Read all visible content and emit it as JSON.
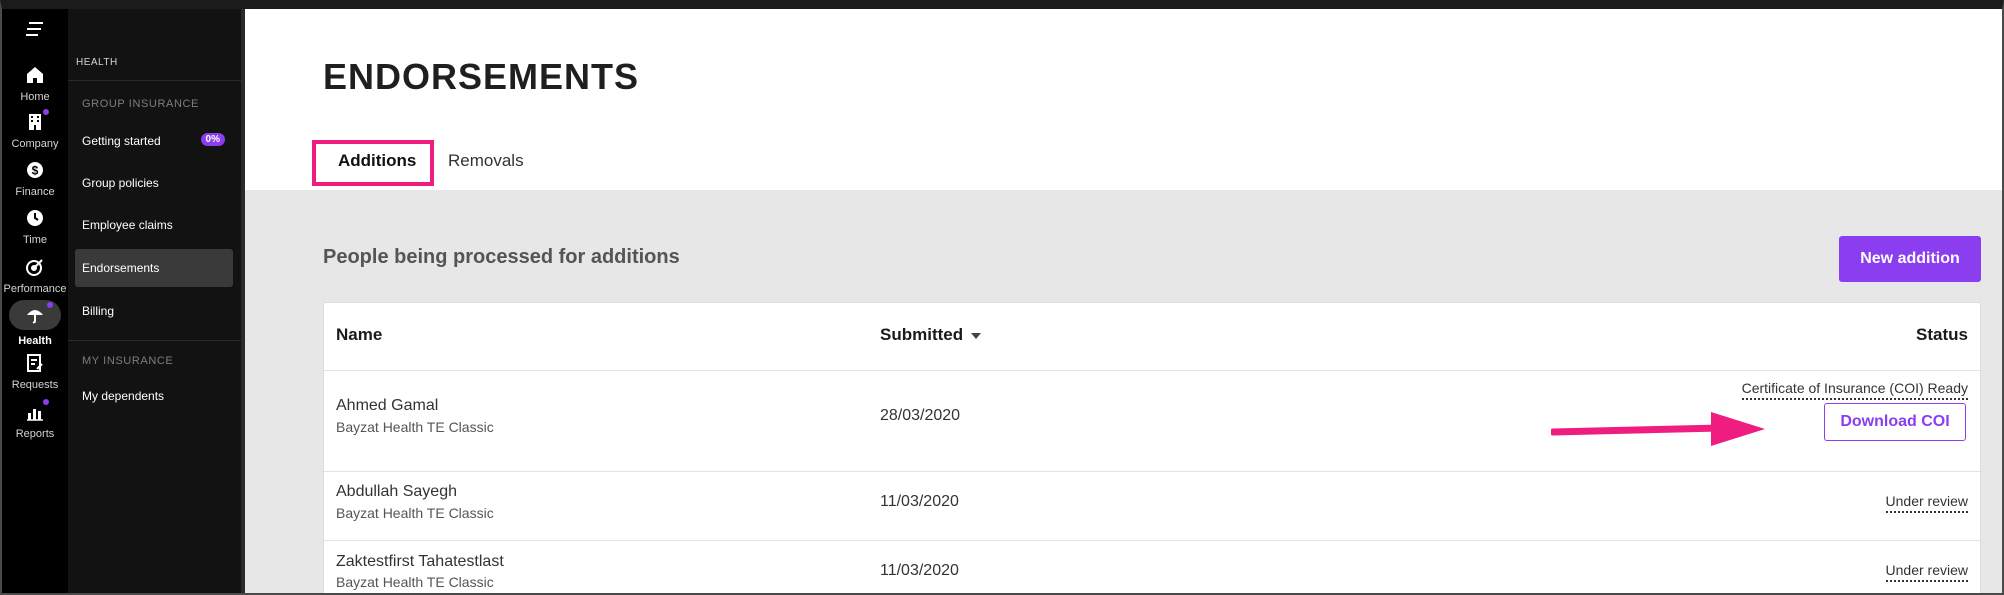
{
  "rail": {
    "items": [
      {
        "label": "Home",
        "icon": "home-icon"
      },
      {
        "label": "Company",
        "icon": "building-icon"
      },
      {
        "label": "Finance",
        "icon": "dollar-icon"
      },
      {
        "label": "Time",
        "icon": "clock-icon"
      },
      {
        "label": "Performance",
        "icon": "target-icon"
      },
      {
        "label": "Health",
        "icon": "umbrella-icon"
      },
      {
        "label": "Requests",
        "icon": "request-icon"
      },
      {
        "label": "Reports",
        "icon": "chart-icon"
      }
    ],
    "active": "Health"
  },
  "subnav": {
    "section": "HEALTH",
    "group1": "GROUP INSURANCE",
    "items1": [
      {
        "label": "Getting started",
        "badge": "0%"
      },
      {
        "label": "Group policies"
      },
      {
        "label": "Employee claims"
      },
      {
        "label": "Endorsements"
      },
      {
        "label": "Billing"
      }
    ],
    "group2": "MY INSURANCE",
    "items2": [
      {
        "label": "My dependents"
      }
    ]
  },
  "main": {
    "title": "ENDORSEMENTS",
    "tabs": [
      {
        "label": "Additions"
      },
      {
        "label": "Removals"
      }
    ],
    "section_title": "People being processed for additions",
    "new_button": "New addition",
    "table": {
      "headers": {
        "name": "Name",
        "submitted": "Submitted",
        "status": "Status"
      },
      "rows": [
        {
          "name": "Ahmed Gamal",
          "plan": "Bayzat Health TE Classic",
          "submitted": "28/03/2020",
          "status": "Certificate of Insurance (COI) Ready",
          "action": "Download COI"
        },
        {
          "name": "Abdullah Sayegh",
          "plan": "Bayzat Health TE Classic",
          "submitted": "11/03/2020",
          "status": "Under review"
        },
        {
          "name": "Zaktestfirst Tahatestlast",
          "plan": "Bayzat Health TE Classic",
          "submitted": "11/03/2020",
          "status": "Under review"
        }
      ]
    }
  },
  "colors": {
    "accent": "#8b3df0",
    "annotation": "#ee1d7f"
  }
}
